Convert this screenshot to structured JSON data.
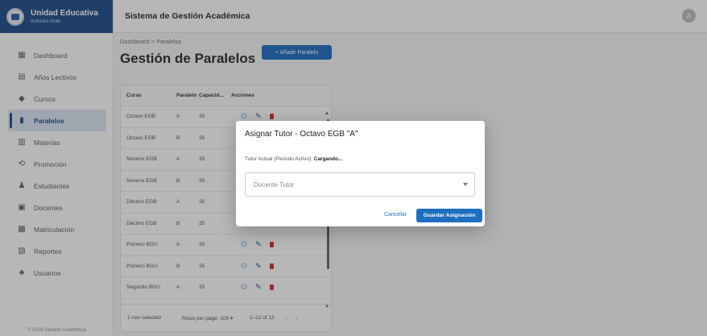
{
  "brand": {
    "title": "Unidad Educativa",
    "subtitle": "Antonio Ante"
  },
  "sidebar": {
    "items": [
      {
        "label": "Dashboard",
        "icon": "dashboard-icon",
        "glyph": "▦"
      },
      {
        "label": "Años Lectivos",
        "icon": "calendar-icon",
        "glyph": "▤"
      },
      {
        "label": "Cursos",
        "icon": "school-icon",
        "glyph": "◆"
      },
      {
        "label": "Paralelos",
        "icon": "class-icon",
        "glyph": "▮",
        "active": true
      },
      {
        "label": "Materias",
        "icon": "book-icon",
        "glyph": "▥"
      },
      {
        "label": "Promoción",
        "icon": "promotion-icon",
        "glyph": "⟲"
      },
      {
        "label": "Estudiantes",
        "icon": "person-icon",
        "glyph": "♟"
      },
      {
        "label": "Docentes",
        "icon": "badge-icon",
        "glyph": "▣"
      },
      {
        "label": "Matriculación",
        "icon": "enrollment-icon",
        "glyph": "▩"
      },
      {
        "label": "Reportes",
        "icon": "report-icon",
        "glyph": "▧"
      },
      {
        "label": "Usuarios",
        "icon": "users-icon",
        "glyph": "♣"
      }
    ],
    "footer": "© 2026 Gestión Académica"
  },
  "topbar": {
    "title": "Sistema de Gestión Académica",
    "avatar": "A"
  },
  "main": {
    "breadcrumb": "Dashboard  >  Paralelos",
    "title": "Gestión de Paralelos",
    "add_button": "+  Añadir Paralelo"
  },
  "table": {
    "columns": [
      "Curso",
      "Paralelo",
      "Capacid...",
      "Acciones"
    ],
    "rows": [
      {
        "curso": "Octavo EGB",
        "paralelo": "A",
        "capacidad": "35"
      },
      {
        "curso": "Octavo EGB",
        "paralelo": "B",
        "capacidad": "35"
      },
      {
        "curso": "Noveno EGB",
        "paralelo": "A",
        "capacidad": "35"
      },
      {
        "curso": "Noveno EGB",
        "paralelo": "B",
        "capacidad": "35"
      },
      {
        "curso": "Décimo EGB",
        "paralelo": "A",
        "capacidad": "35"
      },
      {
        "curso": "Décimo EGB",
        "paralelo": "B",
        "capacidad": "35"
      },
      {
        "curso": "Primero BGU",
        "paralelo": "A",
        "capacidad": "35"
      },
      {
        "curso": "Primero BGU",
        "paralelo": "B",
        "capacidad": "35"
      },
      {
        "curso": "Segundo BGU",
        "paralelo": "A",
        "capacidad": "35"
      }
    ],
    "footer": {
      "selected": "1 row selected",
      "rows_per_page_label": "Rows per page:",
      "rows_per_page_value": "100 ▾",
      "range": "1–12 of 12"
    }
  },
  "dialog": {
    "title": "Asignar Tutor - Octavo EGB \"A\"",
    "status_label": "Tutor Actual (Periodo Activo):",
    "status_value": "Cargando...",
    "select_placeholder": "Docente Tutor",
    "cancel": "Cancelar",
    "save": "Guardar Asignación"
  },
  "colors": {
    "primary": "#1f6fc0",
    "brand": "#1f4e8c",
    "delete": "#d32f2f"
  }
}
